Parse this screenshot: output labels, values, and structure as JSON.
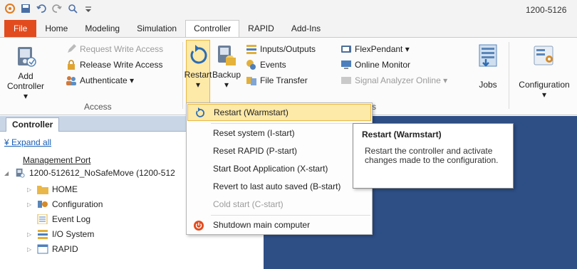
{
  "window": {
    "title": "1200-5126"
  },
  "quick_access": {
    "icons": [
      "app-icon",
      "save-icon",
      "undo-icon",
      "redo-icon",
      "search-icon",
      "customize-icon"
    ]
  },
  "ribbon_tabs": [
    {
      "label": "File"
    },
    {
      "label": "Home"
    },
    {
      "label": "Modeling"
    },
    {
      "label": "Simulation"
    },
    {
      "label": "Controller",
      "active": true
    },
    {
      "label": "RAPID"
    },
    {
      "label": "Add-Ins"
    }
  ],
  "ribbon": {
    "add_controller": {
      "line1": "Add",
      "line2": "Controller ▾"
    },
    "request_write_access": "Request Write Access",
    "release_write_access": "Release Write Access",
    "authenticate": "Authenticate ▾",
    "access_group": "Access",
    "restart": {
      "label": "Restart",
      "arrow": "▾"
    },
    "backup": {
      "label": "Backup",
      "arrow": "▾"
    },
    "inputs_outputs": "Inputs/Outputs",
    "events": "Events",
    "file_transfer": "File Transfer",
    "flexpendant": "FlexPendant ▾",
    "online_monitor": "Online Monitor",
    "signal_analyzer": "Signal Analyzer Online ▾",
    "jobs": "Jobs",
    "configuration": {
      "label": "Configuration",
      "arrow": "▾"
    },
    "group_s": "s"
  },
  "panel": {
    "tab": "Controller",
    "expand_all": "Expand all",
    "management_port": "Management Port",
    "controller_node": "1200-512612_NoSafeMove (1200-512",
    "items": [
      {
        "label": "HOME"
      },
      {
        "label": "Configuration"
      },
      {
        "label": "Event Log"
      },
      {
        "label": "I/O System"
      },
      {
        "label": "RAPID"
      }
    ]
  },
  "restart_menu": {
    "items": [
      {
        "label": "Restart (Warmstart)",
        "highlighted": true
      },
      {
        "label": "Reset system (I-start)"
      },
      {
        "label": "Reset RAPID (P-start)"
      },
      {
        "label": "Start Boot Application (X-start)"
      },
      {
        "label": "Revert to last auto saved (B-start)"
      },
      {
        "label": "Cold start (C-start)",
        "disabled": true
      },
      {
        "label": "Shutdown main computer"
      }
    ]
  },
  "tooltip": {
    "title": "Restart (Warmstart)",
    "body": "Restart the controller and activate changes made to the configuration."
  },
  "colors": {
    "file_tab": "#e24b1e",
    "highlight": "#fde9a8",
    "workspace": "#2e4f86"
  }
}
